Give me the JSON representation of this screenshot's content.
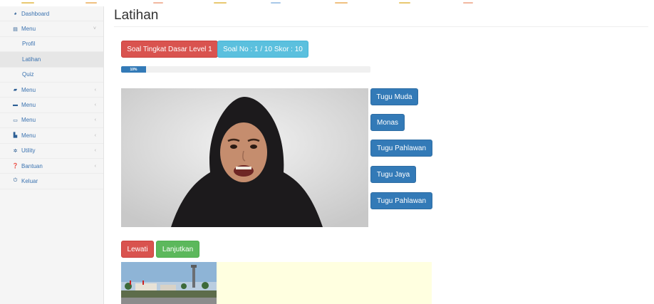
{
  "colors": {
    "primary": "#337ab7",
    "danger": "#d9534f",
    "info": "#5bc0de",
    "success": "#5cb85c",
    "sidebar_link": "#3a72b0",
    "hint_box": "#ffffe0"
  },
  "sidebar": {
    "items": [
      {
        "label": "Dashboard",
        "icon": "dashboard-icon",
        "glyph": "◕"
      },
      {
        "label": "Menu",
        "icon": "table-icon",
        "glyph": "▤",
        "chevron": "˅"
      },
      {
        "label": "Profil"
      },
      {
        "label": "Latihan"
      },
      {
        "label": "Quiz"
      },
      {
        "label": "Menu",
        "icon": "truck-icon",
        "glyph": "▰",
        "chevron": "‹"
      },
      {
        "label": "Menu",
        "icon": "briefcase-icon",
        "glyph": "▬",
        "chevron": "‹"
      },
      {
        "label": "Menu",
        "icon": "id-card-icon",
        "glyph": "▭",
        "chevron": "‹"
      },
      {
        "label": "Menu",
        "icon": "file-icon",
        "glyph": "▙",
        "chevron": "‹"
      },
      {
        "label": "Utility",
        "icon": "gear-icon",
        "glyph": "✲",
        "chevron": "‹"
      },
      {
        "label": "Bantuan",
        "icon": "question-icon",
        "glyph": "❓",
        "chevron": "‹"
      },
      {
        "label": "Keluar",
        "icon": "power-icon",
        "glyph": "⏻"
      }
    ]
  },
  "main": {
    "title": "Latihan",
    "level_label": "Soal Tingkat Dasar Level 1",
    "score_label": "Soal No : 1 / 10 Skor : 10",
    "progress": {
      "label": "10%",
      "percent": 10
    },
    "answers": [
      "Tugu Muda",
      "Monas",
      "Tugu Pahlawan",
      "Tugu Jaya",
      "Tugu Pahlawan"
    ],
    "skip_label": "Lewati",
    "next_label": "Lanjutkan"
  }
}
